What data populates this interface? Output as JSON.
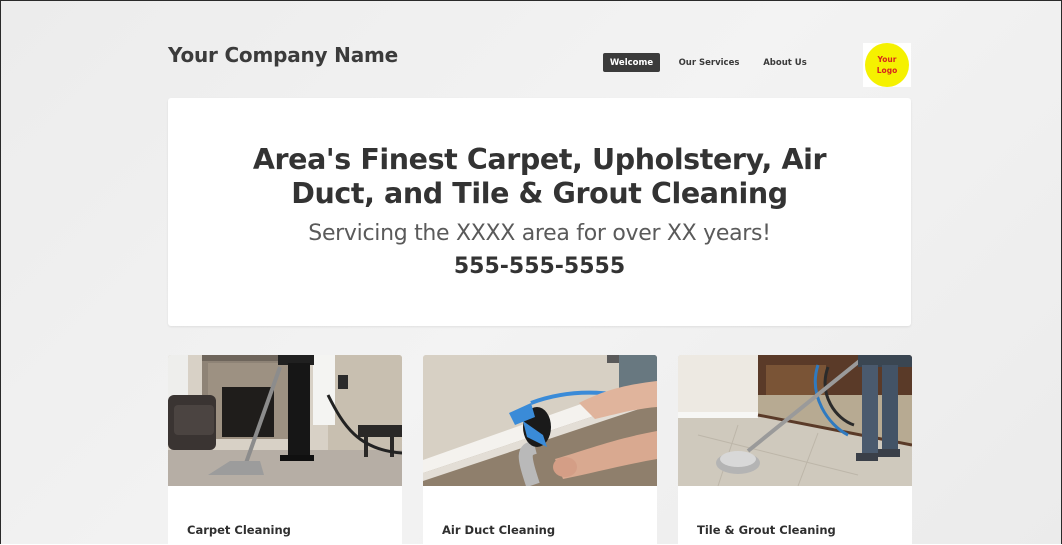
{
  "header": {
    "company_name": "Your Company Name",
    "logo_text_line1": "Your",
    "logo_text_line2": "Logo"
  },
  "nav": {
    "items": [
      {
        "label": "Welcome",
        "active": true
      },
      {
        "label": "Our Services",
        "active": false
      },
      {
        "label": "About Us",
        "active": false
      }
    ]
  },
  "hero": {
    "headline_line1": "Area's Finest Carpet, Upholstery, Air",
    "headline_line2": "Duct, and Tile & Grout Cleaning",
    "subtitle": "Servicing the XXXX area for over XX years!",
    "phone": "555-555-5555"
  },
  "services": [
    {
      "title": "Carpet Cleaning",
      "image": "carpet-cleaning-photo"
    },
    {
      "title": "Air Duct Cleaning",
      "image": "air-duct-cleaning-photo"
    },
    {
      "title": "Tile & Grout Cleaning",
      "image": "tile-grout-cleaning-photo"
    }
  ],
  "colors": {
    "nav_active_bg": "#3b3b3b",
    "logo_fill": "#f5f100",
    "logo_text": "#d6261c",
    "text_dark": "#333333"
  }
}
